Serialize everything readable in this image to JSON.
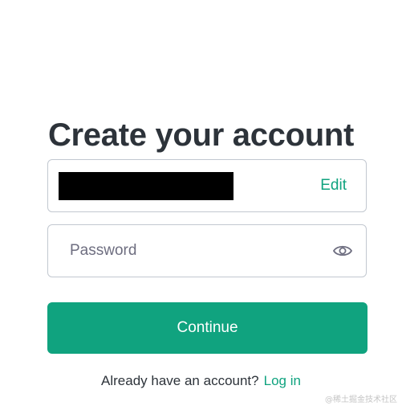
{
  "form": {
    "title": "Create your account",
    "email_edit_label": "Edit",
    "password_placeholder": "Password",
    "password_value": "",
    "continue_label": "Continue",
    "footer_text": "Already have an account?",
    "login_label": "Log in",
    "accent_color": "#10a37f"
  },
  "icons": {
    "password_toggle": "eye-icon"
  },
  "watermark": {
    "text": "@稀土掘金技术社区"
  }
}
